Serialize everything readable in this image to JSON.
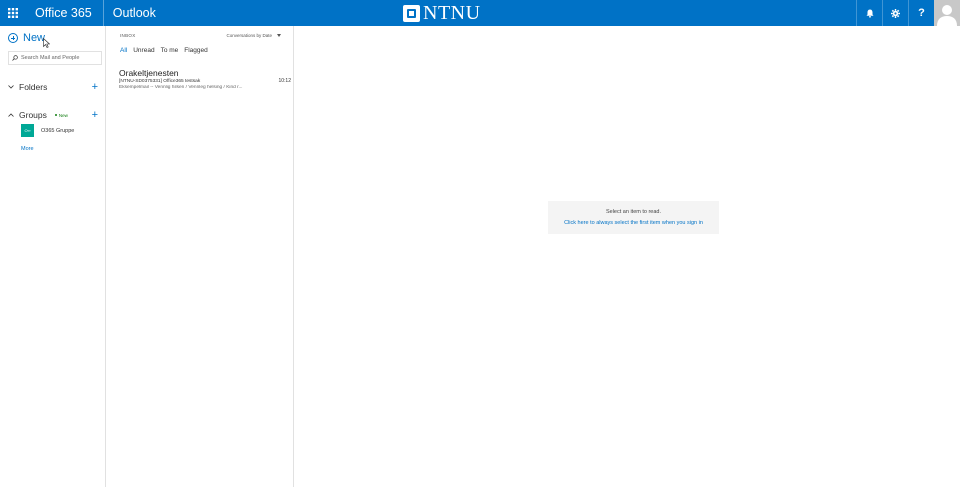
{
  "topbar": {
    "suite_name": "Office 365",
    "app_name": "Outlook",
    "brand": "NTNU",
    "icons": [
      "waffle-icon",
      "bell-icon",
      "gear-icon",
      "help-icon",
      "avatar"
    ],
    "help_label": "?",
    "background_color": "#0072c6"
  },
  "leftnav": {
    "new_label": "New",
    "search_placeholder": "Search Mail and People",
    "folders_label": "Folders",
    "groups_label": "Groups",
    "groups_badge": "New",
    "add_symbol": "+",
    "group_items": [
      {
        "tile_text": "O∞",
        "label": "O365 Gruppe",
        "tile_color": "#00a896"
      }
    ],
    "more_label": "More"
  },
  "msglist": {
    "folder_title": "INBOX",
    "sort_label": "Conversations by Date",
    "filters": [
      "All",
      "Unread",
      "To me",
      "Flagged"
    ],
    "active_filter": "All",
    "messages": [
      {
        "from": "Orakeltjenesten",
        "subject": "[NTNU-SD0375331] Office365 testsak",
        "time": "10:12",
        "preview": "Eksempelmail -- Vennlig hilsen / Vennleg helsing / Kind r..."
      }
    ]
  },
  "reading": {
    "empty_title": "Select an item to read.",
    "empty_link": "Click here to always select the first item when you sign in"
  }
}
